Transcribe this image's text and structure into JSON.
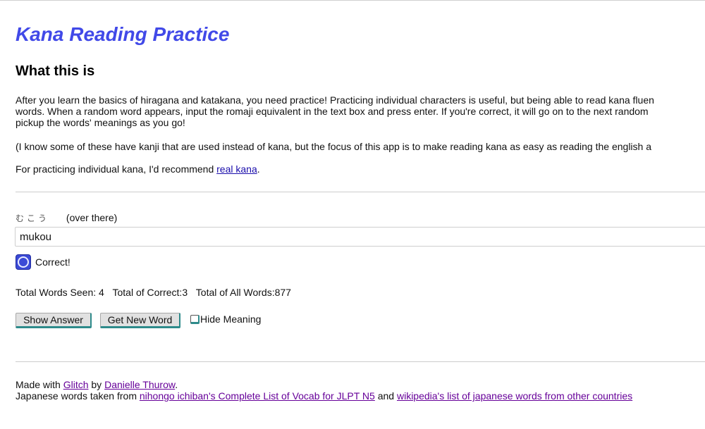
{
  "title": "Kana Reading Practice",
  "section_heading": "What this is",
  "intro": {
    "p1_line1": "After you learn the basics of hiragana and katakana, you need practice! Practicing individual characters is useful, but being able to read kana fluen",
    "p1_line2": "words. When a random word appears, input the romaji equivalent in the text box and press enter. If you're correct, it will go on to the next random",
    "p1_line3": "pickup the words' meanings as you go!",
    "p2": "(I know some of these have kanji that are used instead of kana, but the focus of this app is to make reading kana as easy as reading the english a",
    "p3_prefix": "For practicing individual kana, I'd recommend ",
    "p3_link": "real kana",
    "p3_suffix": "."
  },
  "quiz": {
    "kana": "むこう",
    "meaning": "(over there)",
    "answer_value": "mukou",
    "result_icon": "circle-correct-icon",
    "result_text": "Correct!"
  },
  "stats": {
    "seen_label": "Total Words Seen: ",
    "seen_value": "4",
    "correct_label": "Total of Correct:",
    "correct_value": "3",
    "all_label": "Total of All Words:",
    "all_value": "877"
  },
  "controls": {
    "show_answer": "Show Answer",
    "new_word": "Get New Word",
    "hide_meaning": "Hide Meaning"
  },
  "footer": {
    "made_with": "Made with ",
    "glitch": "Glitch",
    "by": " by ",
    "author": "Danielle Thurow",
    "period": ".",
    "taken_from": "Japanese words taken from ",
    "source1": "nihongo ichiban's Complete List of Vocab for JLPT N5",
    "and": " and ",
    "source2": "wikipedia's list of japanese words from other countries"
  },
  "colors": {
    "title": "#4149e8",
    "link": "#1a0dab",
    "visited_link": "#660099",
    "button_accent": "#2e8b8b",
    "correct_icon": "#3b4ad6"
  }
}
